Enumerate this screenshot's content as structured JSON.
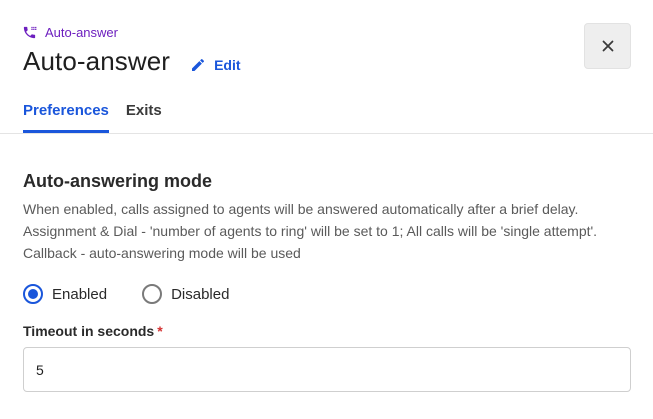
{
  "header": {
    "breadcrumb": "Auto-answer",
    "title": "Auto-answer",
    "edit_label": "Edit"
  },
  "tabs": [
    {
      "label": "Preferences",
      "active": true
    },
    {
      "label": "Exits",
      "active": false
    }
  ],
  "section": {
    "title": "Auto-answering mode",
    "description": "When enabled, calls assigned to agents will be answered automatically after a brief delay. Assignment & Dial - 'number of agents to ring' will be set to 1; All calls will be 'single attempt'. Callback - auto-answering mode will be used"
  },
  "mode": {
    "options": [
      {
        "label": "Enabled",
        "selected": true
      },
      {
        "label": "Disabled",
        "selected": false
      }
    ]
  },
  "timeout": {
    "label": "Timeout in seconds",
    "required_marker": "*",
    "value": "5"
  },
  "colors": {
    "accent": "#1a56db",
    "breadcrumb": "#6d1fbf",
    "required": "#d32f2f"
  },
  "icons": {
    "breadcrumb": "phone-forward-icon",
    "edit": "pencil-icon",
    "close": "close-icon"
  }
}
